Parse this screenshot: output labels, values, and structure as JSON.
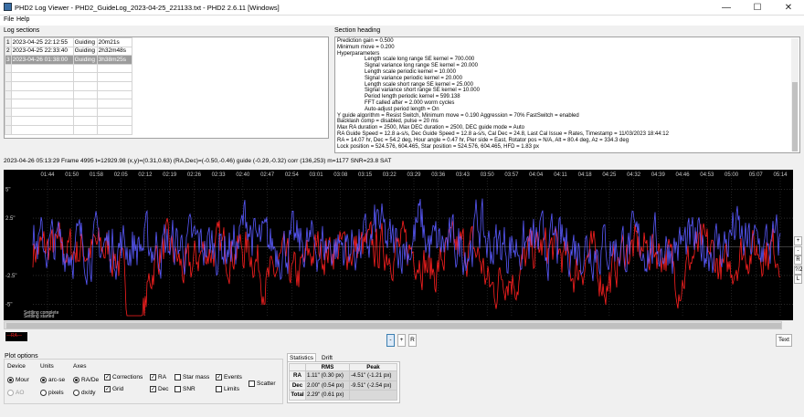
{
  "window": {
    "title": "PHD2 Log Viewer - PHD2_GuideLog_2023-04-25_221133.txt - PHD2 2.6.11 [Windows]",
    "min": "—",
    "max": "☐",
    "close": "✕"
  },
  "menu": {
    "file": "File",
    "help": "Help"
  },
  "log_sections": {
    "label": "Log sections",
    "rows": [
      {
        "n": "1",
        "date": "2023-04-25 22:12:55",
        "type": "Guiding",
        "dur": "20m21s"
      },
      {
        "n": "2",
        "date": "2023-04-25 22:33:40",
        "type": "Guiding",
        "dur": "2h32m48s"
      },
      {
        "n": "3",
        "date": "2023-04-26 01:38:00",
        "type": "Guiding",
        "dur": "3h38m25s"
      }
    ]
  },
  "section_heading": {
    "label": "Section heading",
    "lines": [
      "Prediction gain = 0.500",
      "Minimum move = 0.200",
      "Hyperparameters",
      "Length scale long range SE kernel = 700.000",
      "Signal variance long range SE kernel = 20.000",
      "Length scale periodic kernel = 10.000",
      "Signal variance periodic kernel = 20.000",
      "Length scale short range SE kernel = 25.000",
      "Signal variance short range SE kernel = 10.000",
      "Period length periodic kernel = 599.138",
      "FFT called after = 2.000 worm cycles",
      "Auto-adjust period length = On",
      "Y guide algorithm = Resist Switch, Minimum move = 0.190 Aggression = 70% FastSwitch = enabled",
      "Backlash comp = disabled, pulse = 20 ms",
      "Max RA duration = 2500, Max DEC duration = 2500, DEC guide mode = Auto",
      "RA Guide Speed = 12.8 a-s/s, Dec Guide Speed = 12.8 a-s/s, Cal Dec = 24.8, Last Cal Issue = Rates, Timestamp = 11/03/2023 18:44:12",
      "RA = 14.07 hr, Dec = 54.2 deg, Hour angle = 0.47 hr, Pier side = East, Rotator pos = N/A, Alt = 80.4 deg, Az = 334.3 deg",
      "Lock position = 524.576, 604.465, Star position = 524.576, 604.465, HFD = 1.83 px"
    ]
  },
  "status_line": "2023-04-26 05:13:29 Frame 4995 t=12929.98 (x,y)=(0.31,0.63) (RA,Dec)=(-0.50,-0.46) guide (-0.29,-0.32) corr (136,253) m=1177 SNR=23.8 SAT",
  "chart_data": {
    "type": "line",
    "x_ticks": [
      "01:44",
      "01:50",
      "01:58",
      "02:05",
      "02:12",
      "02:19",
      "02:26",
      "02:33",
      "02:40",
      "02:47",
      "02:54",
      "03:01",
      "03:08",
      "03:15",
      "03:22",
      "03:29",
      "03:36",
      "03:43",
      "03:50",
      "03:57",
      "04:04",
      "04:11",
      "04:18",
      "04:25",
      "04:32",
      "04:39",
      "04:46",
      "04:53",
      "05:00",
      "05:07",
      "05:14"
    ],
    "y_ticks": [
      "5\"",
      "2.5\"",
      "",
      "-2.5\"",
      "-5\""
    ],
    "ylim": [
      -6,
      6
    ],
    "series": [
      {
        "color": "#ff2020"
      },
      {
        "color": "#5a5aff"
      }
    ],
    "annotations": [
      "Settling complete",
      "Settling started"
    ]
  },
  "legend": {
    "ra": "—RA—",
    "dec": "—D—"
  },
  "chart_buttons": {
    "minus": "-",
    "plus": "+",
    "reset": "R",
    "text": "Text"
  },
  "side_buttons": [
    "+",
    "-",
    "R",
    "?/2",
    "L"
  ],
  "plot_options": {
    "label": "Plot options",
    "device": {
      "label": "Device",
      "mount": "Mour",
      "ao": "AO"
    },
    "units": {
      "label": "Units",
      "arcsec": "arc-se",
      "pixels": "pixels"
    },
    "axes": {
      "label": "Axes",
      "radec": "RA/De",
      "dxdy": "dx/dy"
    },
    "checks": {
      "corrections": "Corrections",
      "grid": "Grid",
      "ra": "RA",
      "dec": "Dec",
      "star_mass": "Star mass",
      "snr": "SNR",
      "events": "Events",
      "limits": "Limits",
      "scatter": "Scatter"
    }
  },
  "stats": {
    "tab_stats": "Statistics",
    "tab_drift": "Drift",
    "col_rms": "RMS",
    "col_peak": "Peak",
    "rows": [
      {
        "name": "RA",
        "rms": "1.11\" (0.30 px)",
        "peak": "-4.51\" (-1.21 px)"
      },
      {
        "name": "Dec",
        "rms": "2.00\" (0.54 px)",
        "peak": "-9.51\" (-2.54 px)"
      },
      {
        "name": "Total",
        "rms": "2.29\" (0.61 px)",
        "peak": ""
      }
    ]
  }
}
